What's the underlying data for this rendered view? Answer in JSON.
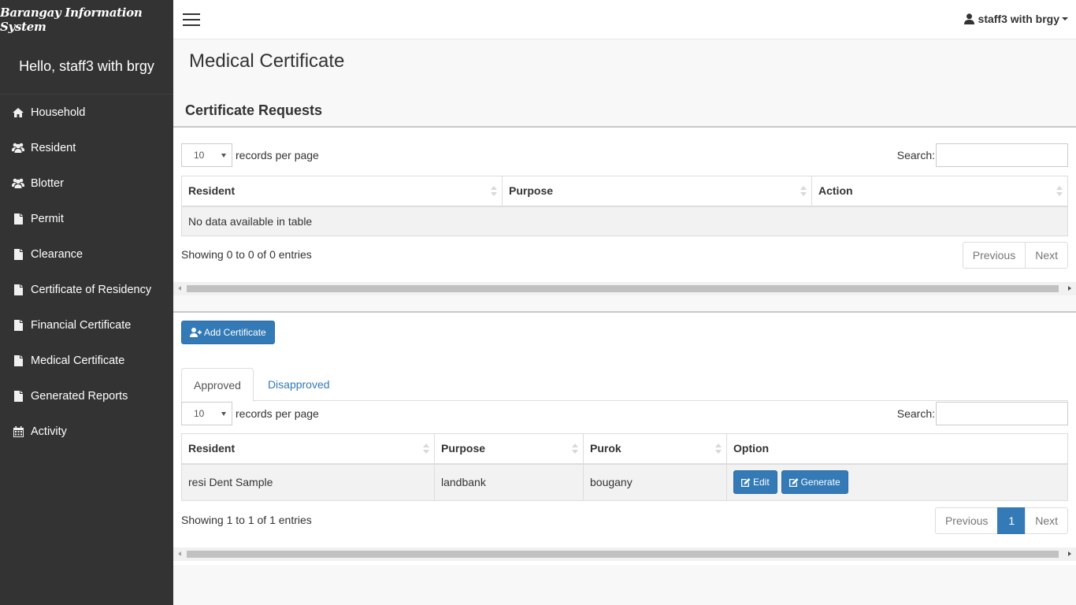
{
  "sidebar": {
    "brand": "Barangay Information System",
    "greeting": "Hello, staff3 with brgy",
    "items": [
      {
        "label": "Household",
        "icon": "home-icon"
      },
      {
        "label": "Resident",
        "icon": "users-icon"
      },
      {
        "label": "Blotter",
        "icon": "users-icon"
      },
      {
        "label": "Permit",
        "icon": "file-icon"
      },
      {
        "label": "Clearance",
        "icon": "file-icon"
      },
      {
        "label": "Certificate of Residency",
        "icon": "file-icon"
      },
      {
        "label": "Financial Certificate",
        "icon": "file-icon"
      },
      {
        "label": "Medical Certificate",
        "icon": "file-icon"
      },
      {
        "label": "Generated Reports",
        "icon": "file-icon"
      },
      {
        "label": "Activity",
        "icon": "calendar-icon"
      }
    ]
  },
  "topbar": {
    "user": "staff3 with brgy"
  },
  "page": {
    "title": "Medical Certificate",
    "requests_title": "Certificate Requests"
  },
  "requests_table": {
    "length_value": "10",
    "length_label": "records per page",
    "search_label": "Search:",
    "search_value": "",
    "columns": [
      "Resident",
      "Purpose",
      "Action"
    ],
    "empty_message": "No data available in table",
    "info": "Showing 0 to 0 of 0 entries",
    "pager": {
      "previous": "Previous",
      "next": "Next"
    }
  },
  "actions": {
    "add_certificate": "Add Certificate"
  },
  "tabs": [
    {
      "label": "Approved",
      "active": true
    },
    {
      "label": "Disapproved",
      "active": false
    }
  ],
  "approved_table": {
    "length_value": "10",
    "length_label": "records per page",
    "search_label": "Search:",
    "search_value": "",
    "columns": [
      "Resident",
      "Purpose",
      "Purok",
      "Option"
    ],
    "rows": [
      {
        "resident": "resi Dent Sample",
        "purpose": "landbank",
        "purok": "bougany",
        "edit_label": "Edit",
        "generate_label": "Generate"
      }
    ],
    "info": "Showing 1 to 1 of 1 entries",
    "pager": {
      "previous": "Previous",
      "current": "1",
      "next": "Next"
    }
  },
  "colors": {
    "sidebar_bg": "#333333",
    "primary": "#337ab7",
    "page_bg": "#f8f8f8"
  }
}
